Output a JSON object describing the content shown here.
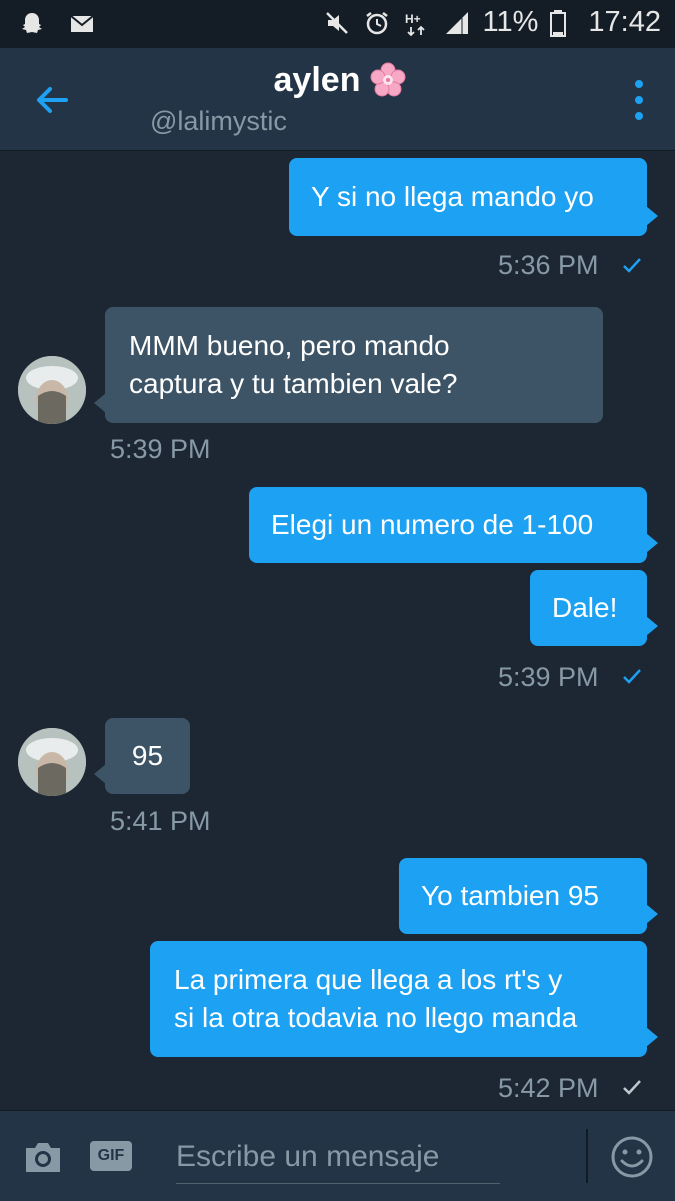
{
  "status_bar": {
    "battery_text": "11%",
    "time": "17:42",
    "icons_left": [
      "snapchat-icon",
      "mail-icon"
    ],
    "icons_right": [
      "mute-icon",
      "alarm-icon",
      "network-hplus-icon",
      "signal-icon",
      "battery-icon"
    ]
  },
  "header": {
    "name": "aylen",
    "name_emoji_icon": "cherry-blossom-icon",
    "handle": "@lalimystic",
    "accent": "#1da1f2"
  },
  "messages": [
    {
      "dir": "out",
      "lines": [
        "Y si no llega mando yo"
      ]
    },
    {
      "meta": "5:36 PM",
      "status": "sent"
    },
    {
      "dir": "in",
      "lines": [
        "MMM bueno, pero mando",
        "captura y tu tambien vale?"
      ]
    },
    {
      "meta": "5:39 PM"
    },
    {
      "dir": "out",
      "lines": [
        "Elegi un numero de 1-100"
      ]
    },
    {
      "dir": "out",
      "lines": [
        "Dale!"
      ]
    },
    {
      "meta": "5:39 PM",
      "status": "sent"
    },
    {
      "dir": "in",
      "lines": [
        "95"
      ]
    },
    {
      "meta": "5:41 PM"
    },
    {
      "dir": "out",
      "lines": [
        "Yo tambien 95"
      ]
    },
    {
      "dir": "out",
      "lines": [
        "La primera que llega a los rt's y",
        "si la otra todavia no llego manda"
      ]
    },
    {
      "meta": "5:42 PM",
      "status": "read"
    }
  ],
  "composer": {
    "placeholder": "Escribe un mensaje",
    "gif_label": "GIF"
  },
  "colors": {
    "background": "#1c2733",
    "header": "#243447",
    "outgoing": "#1da1f2",
    "incoming": "#3d5466",
    "muted": "#8899a6"
  }
}
